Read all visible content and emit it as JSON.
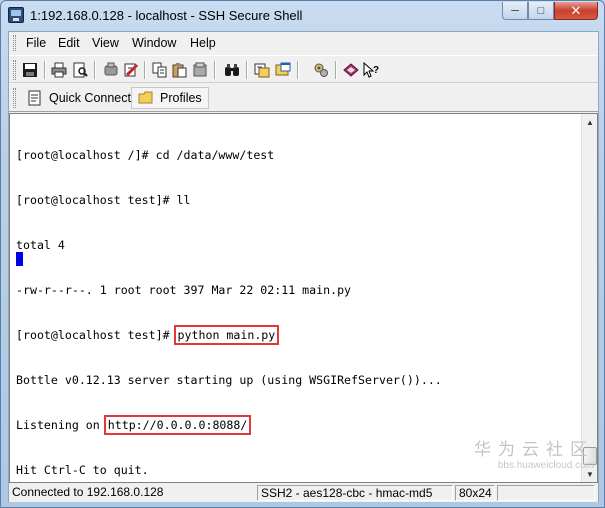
{
  "window": {
    "title": "1:192.168.0.128 - localhost - SSH Secure Shell"
  },
  "menu": [
    "File",
    "Edit",
    "View",
    "Window",
    "Help"
  ],
  "toolbar": {
    "icons": [
      "save-icon",
      "print-icon",
      "print-preview-icon",
      "disconnect-icon",
      "settings-icon",
      "copy-icon",
      "paste-icon",
      "clear-icon",
      "find-icon",
      "file-transfer-icon",
      "new-window-icon",
      "tools-icon",
      "help-book-icon",
      "context-help-icon"
    ]
  },
  "quickbar": {
    "quick_connect": "Quick Connect",
    "profiles": "Profiles"
  },
  "terminal": {
    "lines": [
      "[root@localhost /]# cd /data/www/test",
      "[root@localhost test]# ll",
      "total 4",
      "-rw-r--r--. 1 root root 397 Mar 22 02:11 main.py",
      "[root@localhost test]# ",
      "Bottle v0.12.13 server starting up (using WSGIRefServer())...",
      "Listening on ",
      "Hit Ctrl-C to quit."
    ],
    "highlight_command": "python main.py",
    "highlight_url": "http://0.0.0.0:8088/",
    "highlight_color": "#e0393a",
    "cursor_color": "#0000e8"
  },
  "status": {
    "connection": "Connected to 192.168.0.128",
    "cipher": "SSH2 - aes128-cbc - hmac-md5",
    "size": "80x24"
  },
  "watermark": {
    "text": "华为云社区",
    "url": "bbs.huaweicloud.com"
  }
}
